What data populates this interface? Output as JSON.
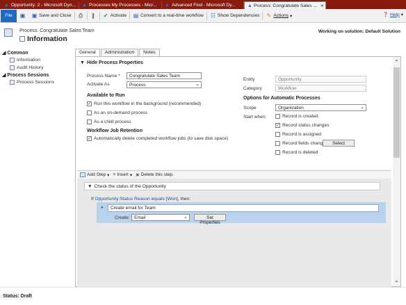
{
  "browser_tabs": [
    {
      "label": "Opportunity: 2 - Microsoft Dyn...",
      "active": false
    },
    {
      "label": "Processes My Processes - Micr...",
      "active": false
    },
    {
      "label": "Advanced Find - Microsoft Dy...",
      "active": false
    },
    {
      "label": "Process: Congratulate Sales ...",
      "active": true,
      "close": "✕"
    }
  ],
  "ribbon": {
    "file": "File",
    "save_close": "Save and Close",
    "activate": "Activate",
    "convert": "Convert to a real-time workflow",
    "dependencies": "Show Dependencies",
    "actions": "Actions",
    "help": "Help"
  },
  "header": {
    "breadcrumb": "Process: Congratulate Sales Team",
    "title": "Information",
    "solution": "Working on solution: Default Solution"
  },
  "nav": {
    "common_label": "Common",
    "common_items": [
      "Information",
      "Audit History"
    ],
    "sessions_label": "Process Sessions",
    "sessions_items": [
      "Process Sessions"
    ]
  },
  "tabs": [
    "General",
    "Administration",
    "Notes"
  ],
  "section_title": "Hide Process Properties",
  "form": {
    "process_name_label": "Process Name",
    "required_mark": "*",
    "process_name_value": "Congratulate Sales Team",
    "activate_as_label": "Activate As",
    "activate_as_value": "Process",
    "available_to_run": "Available to Run",
    "run_background": "Run this workflow in the background (recommended)",
    "on_demand": "As an on-demand process",
    "child_process": "As a child process",
    "retention_title": "Workflow Job Retention",
    "auto_delete": "Automatically delete completed workflow jobs (to save disk space)",
    "entity_label": "Entity",
    "entity_value": "Opportunity",
    "category_label": "Category",
    "category_value": "Workflow",
    "auto_options_title": "Options for Automatic Processes",
    "scope_label": "Scope",
    "scope_value": "Organization",
    "start_when_label": "Start when:",
    "start_options": [
      "Record is created",
      "Record status changes",
      "Record is assigned",
      "Record fields change",
      "Record is deleted"
    ],
    "select_button": "Select"
  },
  "designer": {
    "add_step": "Add Step",
    "insert": "Insert",
    "delete": "Delete this step.",
    "step1": "Check the status of the Opportunity",
    "cond_prefix": "If",
    "cond_link": "Opportunity:Status Reason equals [Won]",
    "cond_suffix": ", then:",
    "sub_step": "Create email for Team",
    "create_label": "Create:",
    "create_value": "Email",
    "set_properties": "Set Properties"
  },
  "status": "Status: Draft"
}
